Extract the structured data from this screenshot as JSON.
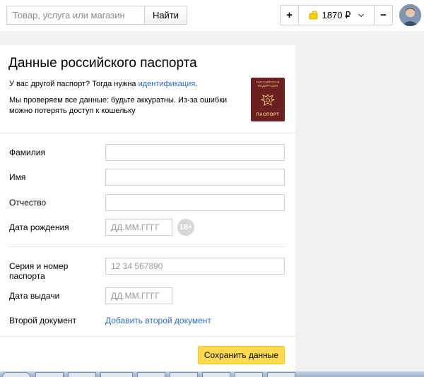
{
  "header": {
    "search_placeholder": "Товар, услуга или магазин",
    "search_button": "Найти",
    "wallet": {
      "plus": "+",
      "balance": "1870 ₽",
      "minus": "−"
    }
  },
  "form": {
    "title": "Данные российского паспорта",
    "intro_text": "У вас другой паспорт? Тогда нужна ",
    "intro_link": "идентификация",
    "intro_end": ".",
    "warning": "Мы проверяем все данные: будьте аккуратны. Из-за ошибки можно потерять доступ к кошельку",
    "passport_image": {
      "top_text": "РОССИЙСКАЯ ФЕДЕРАЦИЯ",
      "bottom_text": "ПАСПОРТ"
    },
    "fields": {
      "surname_label": "Фамилия",
      "name_label": "Имя",
      "patronymic_label": "Отчество",
      "birthdate_label": "Дата рождения",
      "birthdate_placeholder": "ДД.ММ.ГГГГ",
      "age_badge": "18+",
      "series_label": "Серия и номер паспорта",
      "series_placeholder": "12 34 567890",
      "issue_date_label": "Дата выдачи",
      "issue_date_placeholder": "ДД.ММ.ГГГГ",
      "second_doc_label": "Второй документ",
      "second_doc_link": "Добавить второй документ"
    },
    "save_button": "Сохранить данные"
  },
  "colors": {
    "accent_yellow": "#ffdb4d",
    "link_blue": "#2a6cc3",
    "passport_red": "#6b1f1f"
  }
}
